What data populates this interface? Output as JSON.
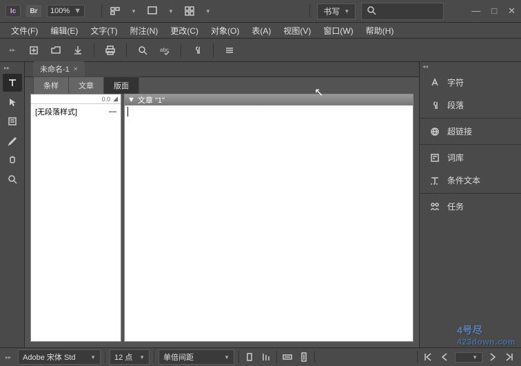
{
  "app": {
    "icon_label": "Ic",
    "br_label": "Br",
    "zoom": "100%"
  },
  "workspace": {
    "label": "书写"
  },
  "search": {
    "placeholder": ""
  },
  "menu": {
    "items": [
      {
        "label": "文件(F)"
      },
      {
        "label": "编辑(E)"
      },
      {
        "label": "文字(T)"
      },
      {
        "label": "附注(N)"
      },
      {
        "label": "更改(C)"
      },
      {
        "label": "对象(O)"
      },
      {
        "label": "表(A)"
      },
      {
        "label": "视图(V)"
      },
      {
        "label": "窗口(W)"
      },
      {
        "label": "帮助(H)"
      }
    ]
  },
  "document_tab": {
    "title": "未命名-1",
    "dirty_close": "×"
  },
  "panel_tabs": [
    {
      "label": "条样",
      "active": false
    },
    {
      "label": "文章",
      "active": false
    },
    {
      "label": "版面",
      "active": true
    }
  ],
  "style_panel": {
    "header_value": "0.0",
    "rows": [
      {
        "label": "[无段落样式]",
        "suffix": "—"
      }
    ]
  },
  "editor": {
    "header_title": "文章 \"1\""
  },
  "right_panel": {
    "items": [
      {
        "icon": "character-icon",
        "label": "字符"
      },
      {
        "icon": "paragraph-icon",
        "label": "段落"
      },
      {
        "icon": "hyperlink-icon",
        "label": "超链接"
      },
      {
        "icon": "thesaurus-icon",
        "label": "词库"
      },
      {
        "icon": "conditional-text-icon",
        "label": "条件文本"
      },
      {
        "icon": "task-icon",
        "label": "任务"
      }
    ]
  },
  "statusbar": {
    "font": "Adobe 宋体 Std",
    "font_size": "12 点",
    "leading": "单倍间距"
  },
  "watermark": {
    "line1": "4号尽",
    "line2": "423down.com"
  }
}
